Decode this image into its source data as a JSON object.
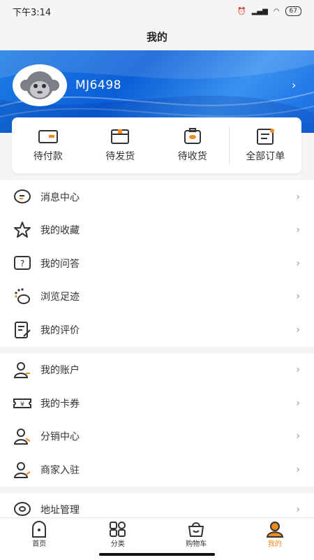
{
  "status": {
    "time": "下午3:14",
    "battery": "67"
  },
  "header": {
    "title": "我的"
  },
  "profile": {
    "username": "MJ6498"
  },
  "orders": [
    {
      "label": "待付款"
    },
    {
      "label": "待发货"
    },
    {
      "label": "待收货"
    },
    {
      "label": "全部订单"
    }
  ],
  "menu": [
    {
      "label": "消息中心",
      "icon": "message-icon"
    },
    {
      "label": "我的收藏",
      "icon": "star-icon"
    },
    {
      "label": "我的问答",
      "icon": "question-icon"
    },
    {
      "label": "浏览足迹",
      "icon": "footprint-icon"
    },
    {
      "label": "我的评价",
      "icon": "review-icon"
    },
    {
      "label": "我的账户",
      "icon": "account-icon"
    },
    {
      "label": "我的卡券",
      "icon": "coupon-icon"
    },
    {
      "label": "分销中心",
      "icon": "distribution-icon"
    },
    {
      "label": "商家入驻",
      "icon": "merchant-icon"
    },
    {
      "label": "地址管理",
      "icon": "location-icon"
    }
  ],
  "tabs": [
    {
      "label": "首页"
    },
    {
      "label": "分类"
    },
    {
      "label": "购物车"
    },
    {
      "label": "我的"
    }
  ],
  "colors": {
    "accent": "#f08a1a",
    "banner": "#1368e0"
  }
}
